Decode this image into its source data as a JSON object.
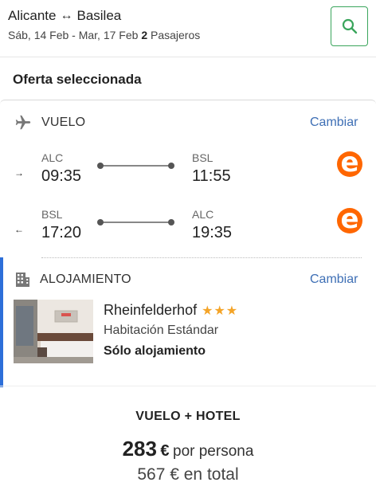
{
  "header": {
    "origin": "Alicante",
    "destination": "Basilea",
    "dates": "Sáb, 14 Feb - Mar, 17 Feb",
    "passengers_count": "2",
    "passengers_label": "Pasajeros"
  },
  "offer_title": "Oferta seleccionada",
  "flight": {
    "label": "VUELO",
    "change_label": "Cambiar",
    "legs": [
      {
        "direction": "→",
        "from_code": "ALC",
        "from_time": "09:35",
        "to_code": "BSL",
        "to_time": "11:55",
        "airline_logo": "e"
      },
      {
        "direction": "←",
        "from_code": "BSL",
        "from_time": "17:20",
        "to_code": "ALC",
        "to_time": "19:35",
        "airline_logo": "e"
      }
    ]
  },
  "hotel": {
    "label": "ALOJAMIENTO",
    "change_label": "Cambiar",
    "name": "Rheinfelderhof",
    "stars": "★★★",
    "room": "Habitación Estándar",
    "board": "Sólo alojamiento"
  },
  "summary": {
    "package": "VUELO + HOTEL",
    "price_per_person": "283",
    "currency": "€",
    "per_person_label": "por persona",
    "total_price": "567",
    "total_label": "€ en total"
  },
  "colors": {
    "accent_green": "#3aa55c",
    "link_blue": "#3e6fb5",
    "airline_orange": "#ff6600",
    "hotel_bar_blue": "#2d6fd9",
    "star_gold": "#f4a428"
  },
  "icons": [
    "search-icon",
    "plane-icon",
    "building-icon"
  ]
}
